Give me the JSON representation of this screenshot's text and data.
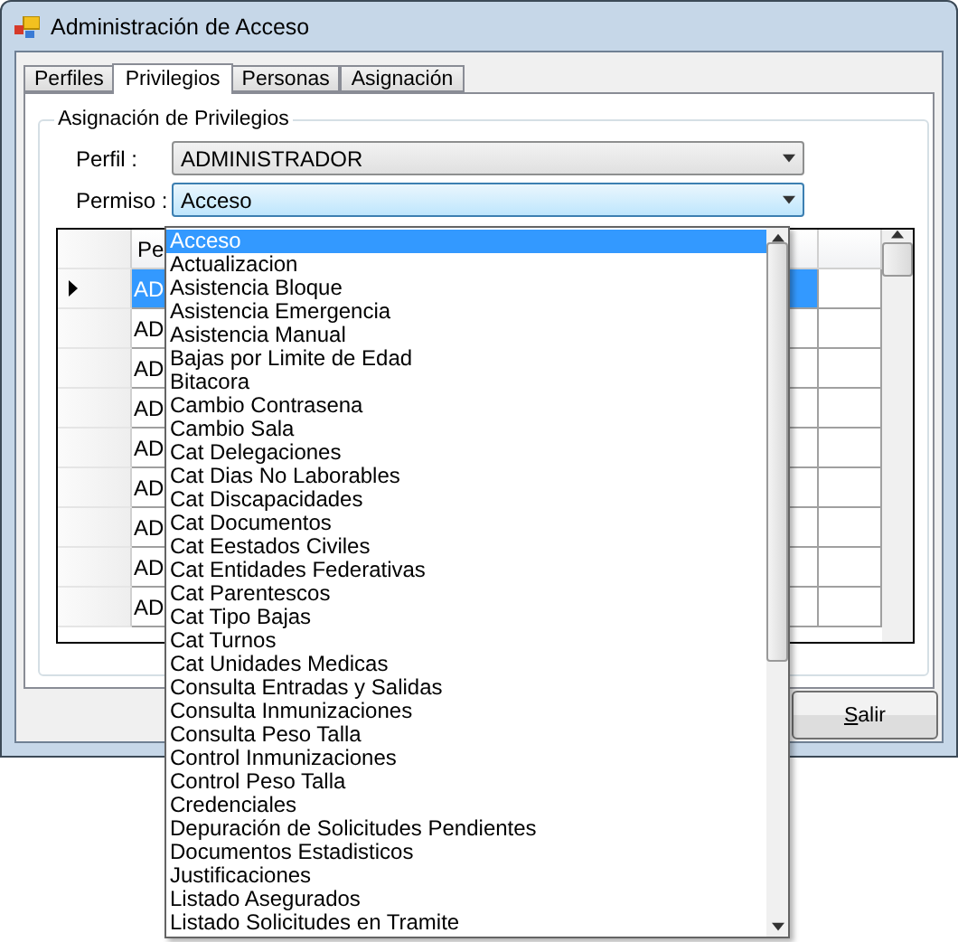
{
  "window": {
    "title": "Administración de Acceso"
  },
  "tabs": [
    {
      "label": "Perfiles",
      "selected": false
    },
    {
      "label": "Privilegios",
      "selected": true
    },
    {
      "label": "Personas",
      "selected": false
    },
    {
      "label": "Asignación",
      "selected": false
    }
  ],
  "group": {
    "title": "Asignación de Privilegios"
  },
  "perfil": {
    "label": "Perfil :",
    "value": "ADMINISTRADOR"
  },
  "permiso": {
    "label": "Permiso :",
    "value": "Acceso",
    "expanded": true,
    "options": [
      {
        "label": "Acceso",
        "selected": true
      },
      {
        "label": "Actualizacion",
        "selected": false
      },
      {
        "label": "Asistencia Bloque",
        "selected": false
      },
      {
        "label": "Asistencia Emergencia",
        "selected": false
      },
      {
        "label": "Asistencia Manual",
        "selected": false
      },
      {
        "label": "Bajas por Limite de Edad",
        "selected": false
      },
      {
        "label": "Bitacora",
        "selected": false
      },
      {
        "label": "Cambio Contrasena",
        "selected": false
      },
      {
        "label": "Cambio Sala",
        "selected": false
      },
      {
        "label": "Cat Delegaciones",
        "selected": false
      },
      {
        "label": "Cat Dias No Laborables",
        "selected": false
      },
      {
        "label": "Cat Discapacidades",
        "selected": false
      },
      {
        "label": "Cat Documentos",
        "selected": false
      },
      {
        "label": "Cat Eestados Civiles",
        "selected": false
      },
      {
        "label": "Cat Entidades Federativas",
        "selected": false
      },
      {
        "label": "Cat Parentescos",
        "selected": false
      },
      {
        "label": "Cat Tipo Bajas",
        "selected": false
      },
      {
        "label": "Cat Turnos",
        "selected": false
      },
      {
        "label": "Cat Unidades Medicas",
        "selected": false
      },
      {
        "label": "Consulta Entradas y Salidas",
        "selected": false
      },
      {
        "label": "Consulta Inmunizaciones",
        "selected": false
      },
      {
        "label": "Consulta Peso Talla",
        "selected": false
      },
      {
        "label": "Control Inmunizaciones",
        "selected": false
      },
      {
        "label": "Control Peso Talla",
        "selected": false
      },
      {
        "label": "Credenciales",
        "selected": false
      },
      {
        "label": "Depuración de Solicitudes Pendientes",
        "selected": false
      },
      {
        "label": "Documentos Estadisticos",
        "selected": false
      },
      {
        "label": "Justificaciones",
        "selected": false
      },
      {
        "label": "Listado Asegurados",
        "selected": false
      },
      {
        "label": "Listado Solicitudes en Tramite",
        "selected": false
      }
    ]
  },
  "table": {
    "columns": [
      "Pe"
    ],
    "rows": [
      {
        "cells": [
          "AD"
        ],
        "selected": true
      },
      {
        "cells": [
          "AD"
        ],
        "selected": false
      },
      {
        "cells": [
          "AD"
        ],
        "selected": false
      },
      {
        "cells": [
          "AD"
        ],
        "selected": false
      },
      {
        "cells": [
          "AD"
        ],
        "selected": false
      },
      {
        "cells": [
          "AD"
        ],
        "selected": false
      },
      {
        "cells": [
          "AD"
        ],
        "selected": false
      },
      {
        "cells": [
          "AD"
        ],
        "selected": false
      },
      {
        "cells": [
          "AD"
        ],
        "selected": false
      }
    ]
  },
  "buttons": [
    {
      "label": "Salir"
    }
  ]
}
